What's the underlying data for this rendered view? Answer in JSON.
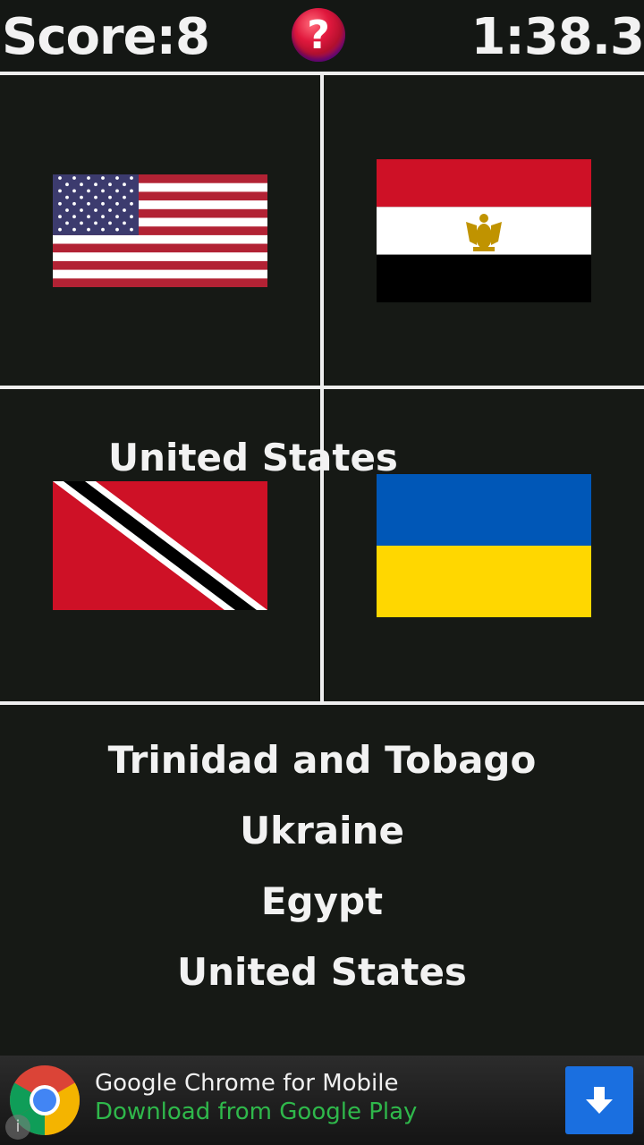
{
  "header": {
    "score_text": "Score:8",
    "timer_text": "1:38.3",
    "help_symbol": "?",
    "help_icon": "question-mark-icon"
  },
  "grid": {
    "cells": [
      {
        "flag": "United States flag"
      },
      {
        "flag": "Egypt flag"
      },
      {
        "flag": "Trinidad and Tobago flag"
      },
      {
        "flag": "Ukraine flag"
      }
    ],
    "overlay_label": "United States"
  },
  "options": [
    "Trinidad and Tobago",
    "Ukraine",
    "Egypt",
    "United States"
  ],
  "ad": {
    "title": "Google Chrome for Mobile",
    "subtitle": "Download from Google Play",
    "logo_icon": "chrome-logo-icon",
    "download_icon": "download-arrow-icon",
    "info_icon": "info-icon",
    "info_symbol": "i"
  },
  "colors": {
    "background": "#161915",
    "grid_line": "#eeeeee",
    "text": "#f2f2f2",
    "ad_subtitle": "#2fb84b",
    "download_button": "#1a6fe0"
  }
}
